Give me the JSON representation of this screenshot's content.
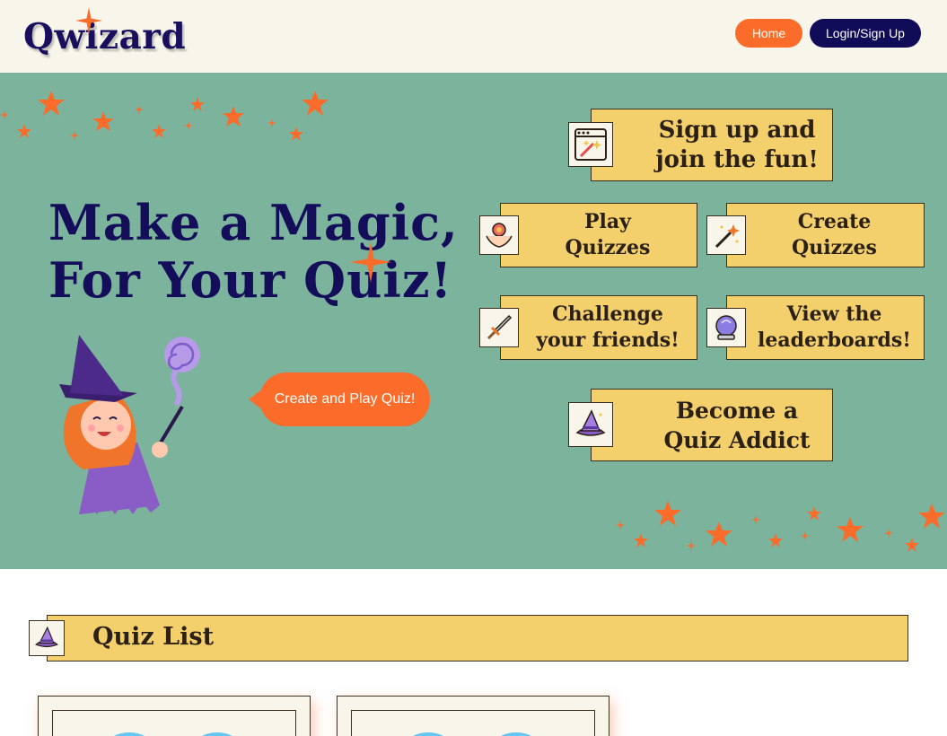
{
  "header": {
    "logo_text": "Qwizard",
    "nav": {
      "home_label": "Home",
      "login_label": "Login/Sign Up"
    }
  },
  "hero": {
    "headline_line1": "Make a Magic,",
    "headline_line2": "For Your Quiz!",
    "cta_label": "Create and Play Quiz!",
    "features": {
      "signup": {
        "line1": "Sign up and",
        "line2": "join the fun!",
        "icon": "magic-window-icon"
      },
      "play": {
        "line1": "Play",
        "line2": "Quizzes",
        "icon": "hands-flower-icon"
      },
      "create": {
        "line1": "Create",
        "line2": "Quizzes",
        "icon": "magic-wand-icon"
      },
      "challenge": {
        "line1": "Challenge",
        "line2": "your friends!",
        "icon": "sword-icon"
      },
      "leaderboards": {
        "line1": "View the",
        "line2": "leaderboards!",
        "icon": "crystal-ball-icon"
      },
      "addict": {
        "line1": "Become a",
        "line2": "Quiz Addict",
        "icon": "witch-hat-icon"
      }
    }
  },
  "quiz_list": {
    "title": "Quiz List",
    "icon": "witch-hat-icon"
  },
  "colors": {
    "accent_orange": "#fb6c2b",
    "navy": "#110c57",
    "hero_green": "#7bb39d",
    "card_yellow": "#f4d06d",
    "cream": "#f8f6eb"
  }
}
